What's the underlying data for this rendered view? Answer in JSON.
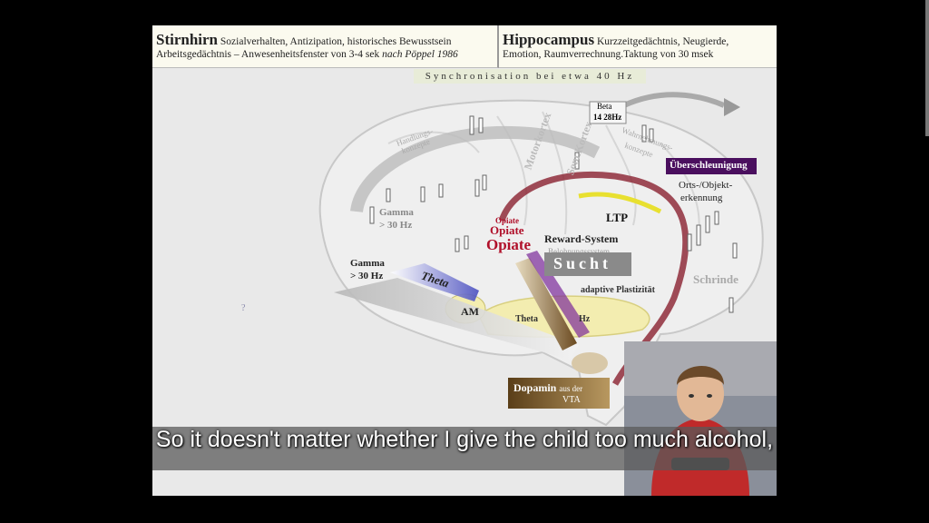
{
  "header": {
    "left_title": "Stirnhirn",
    "left_line1": "Sozialverhalten, Antizipation, historisches Bewusstsein",
    "left_line2": "Arbeitsgedächtnis – Anwesenheitsfenster von 3-4 sek",
    "left_cite": "nach Pöppel 1986",
    "right_title": "Hippocampus",
    "right_line1": "Kurzzeitgedächtnis, Neugierde,",
    "right_line2": "Emotion, Raumverrechnung.Taktung von 30 msek"
  },
  "sync": "Synchronisation   bei etwa 40 Hz",
  "labels": {
    "beta": "Beta",
    "beta_hz": "14 28Hz",
    "ueberschleunigung": "Überschleunigung",
    "orts": "Orts-/Objekt-",
    "erkennung": "erkennung",
    "gamma_top": "Gamma",
    "gamma_top_hz": "> 30 Hz",
    "gamma_left": "Gamma",
    "gamma_left_hz": "> 30 Hz",
    "theta": "Theta",
    "ltp": "LTP",
    "opiate_small": "Opiate",
    "opiate_mid": "Opiate",
    "opiate_big": "Opiate",
    "reward": "Reward-System",
    "belohnung": "Belohnungssystem",
    "sucht": "Sucht",
    "adaptive": "adaptive Plastizität",
    "am": "AM",
    "theta_small": "Theta",
    "hz_small": "Hz",
    "schrinde": "Schrinde",
    "motorkortex": "Motorkortex",
    "somkortex": "Som.Kortex",
    "handlungs": "Handlungs-",
    "konzepte_l": "konzepte",
    "wahrnehmungs": "Wahrnehmungs-",
    "konzepte_r": "konzepte",
    "dopamin": "Dopamin",
    "dopamin_sub": "aus der",
    "vta": "VTA",
    "question": "?"
  },
  "subtitle": "So it doesn't matter whether I give the child too much alcohol,",
  "colors": {
    "purple": "#4a0f5e",
    "red_opiate": "#b0102a",
    "theta_blue": "#4a4fc0",
    "dopamin_brown": "#7a5a30"
  }
}
